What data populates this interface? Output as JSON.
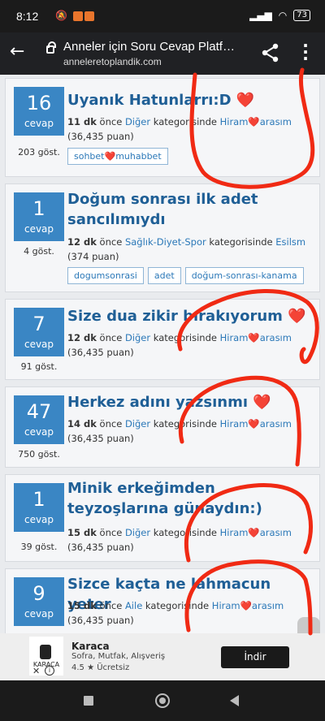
{
  "status_bar": {
    "time": "8:12",
    "battery": "73"
  },
  "browser": {
    "title": "Anneler için Soru Cevap Platf…",
    "url": "anneleretoplandik.com"
  },
  "questions": [
    {
      "count": "16",
      "count_label": "cevap",
      "views": "203 göst.",
      "title": "Uyanık Hatunlarrı:D ❤️",
      "time": "11 dk",
      "before": " önce ",
      "category": "Diğer",
      "cat_suffix": " kategorisinde ",
      "user": "Hiram❤️arasım",
      "points": "(36,435 puan)",
      "tags": [
        "sohbet❤️muhabbet"
      ]
    },
    {
      "count": "1",
      "count_label": "cevap",
      "views": "4 göst.",
      "title": "Doğum sonrası ilk adet sancılımıydı",
      "time": "12 dk",
      "before": " önce ",
      "category": "Sağlık-Diyet-Spor",
      "cat_suffix": " kategorisinde ",
      "user": "Esilsm",
      "points": "(374 puan)",
      "tags": [
        "dogumsonrasi",
        "adet",
        "doğum-sonrası-kanama"
      ]
    },
    {
      "count": "7",
      "count_label": "cevap",
      "views": "91 göst.",
      "title": "Size dua zikir bırakıyorum ❤️",
      "time": "12 dk",
      "before": " önce ",
      "category": "Diğer",
      "cat_suffix": " kategorisinde ",
      "user": "Hiram❤️arasım",
      "points": "(36,435 puan)",
      "tags": []
    },
    {
      "count": "47",
      "count_label": "cevap",
      "views": "750 göst.",
      "title": "Herkez adını yazsınmı ❤️",
      "time": "14 dk",
      "before": " önce ",
      "category": "Diğer",
      "cat_suffix": " kategorisinde ",
      "user": "Hiram❤️arasım",
      "points": "(36,435 puan)",
      "tags": []
    },
    {
      "count": "1",
      "count_label": "cevap",
      "views": "39 göst.",
      "title": "Minik erkeğimden teyzoşlarına günaydın:)",
      "time": "15 dk",
      "before": " önce ",
      "category": "Diğer",
      "cat_suffix": " kategorisinde ",
      "user": "Hiram❤️arasım",
      "points": "(36,435 puan)",
      "tags": []
    },
    {
      "count": "9",
      "count_label": "cevap",
      "views": "",
      "title": "Sizce kaçta ne lahmacun yeter",
      "time": "15 dk",
      "before": " önce ",
      "category": "Aile",
      "cat_suffix": " kategorisinde ",
      "user": "Hiram❤️arasım",
      "points": "(36,435 puan)",
      "tags": []
    }
  ],
  "ad": {
    "logo_text": "KARACA",
    "brand": "Karaca",
    "category": "Sofra, Mutfak, Alışveriş",
    "rating": "4.5 ★  Ücretsiz",
    "install": "İndir"
  },
  "colors": {
    "accent": "#3a86c4",
    "title": "#1f5f96",
    "scribble": "#f02a14"
  }
}
